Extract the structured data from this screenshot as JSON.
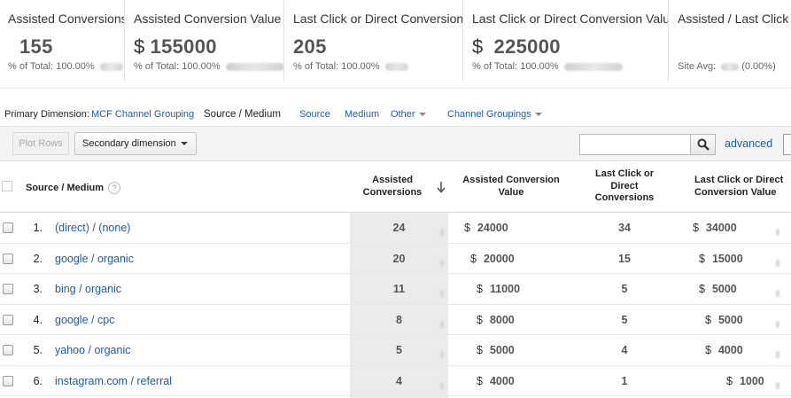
{
  "summary": [
    {
      "label": "Assisted Conversions",
      "currency": "",
      "value": "155",
      "pct": "% of Total: 100.00%"
    },
    {
      "label": "Assisted Conversion Value",
      "currency": "$",
      "value": "155000",
      "pct": "% of Total: 100.00%"
    },
    {
      "label": "Last Click or Direct Conversions",
      "currency": "",
      "value": "205",
      "pct": "% of Total: 100.00%"
    },
    {
      "label": "Last Click or Direct Conversion Value",
      "currency": "$",
      "value": "225000",
      "pct": "% of Total: 100.00%"
    },
    {
      "label": "Assisted / Last Click or Direct Conversions",
      "currency": "",
      "value": "",
      "pct_prefix": "Site Avg:",
      "pct_suffix": "(0.00%)"
    }
  ],
  "primary_dimension": {
    "label": "Primary Dimension:",
    "options": [
      "MCF Channel Grouping",
      "Source / Medium",
      "Source",
      "Medium",
      "Other"
    ],
    "selected": "Source / Medium",
    "channel_groupings": "Channel Groupings"
  },
  "toolbar": {
    "plot_rows": "Plot Rows",
    "secondary_dimension": "Secondary dimension",
    "search_value": "",
    "advanced": "advanced"
  },
  "table": {
    "headers": {
      "source_medium": "Source / Medium",
      "help": "?",
      "assisted_conversions_1": "Assisted",
      "assisted_conversions_2": "Conversions",
      "assisted_value_1": "Assisted Conversion",
      "assisted_value_2": "Value",
      "last_click_1": "Last Click or",
      "last_click_2": "Direct",
      "last_click_3": "Conversions",
      "last_click_value_1": "Last Click or Direct",
      "last_click_value_2": "Conversion Value"
    },
    "currency": "$",
    "rows": [
      {
        "idx": "1.",
        "source": "(direct) / (none)",
        "assisted": "24",
        "assisted_value": "24000",
        "last_click": "34",
        "last_click_value": "34000"
      },
      {
        "idx": "2.",
        "source": "google / organic",
        "assisted": "20",
        "assisted_value": "20000",
        "last_click": "15",
        "last_click_value": "15000"
      },
      {
        "idx": "3.",
        "source": "bing / organic",
        "assisted": "11",
        "assisted_value": "11000",
        "last_click": "5",
        "last_click_value": "5000"
      },
      {
        "idx": "4.",
        "source": "google / cpc",
        "assisted": "8",
        "assisted_value": "8000",
        "last_click": "5",
        "last_click_value": "5000"
      },
      {
        "idx": "5.",
        "source": "yahoo / organic",
        "assisted": "5",
        "assisted_value": "5000",
        "last_click": "4",
        "last_click_value": "4000"
      },
      {
        "idx": "6.",
        "source": "instagram.com / referral",
        "assisted": "4",
        "assisted_value": "4000",
        "last_click": "1",
        "last_click_value": "1000"
      }
    ]
  },
  "colors": {
    "link": "#1f5b9e",
    "shaded_column": "#ebebeb",
    "toolbar_bg": "#f3f3f3"
  }
}
